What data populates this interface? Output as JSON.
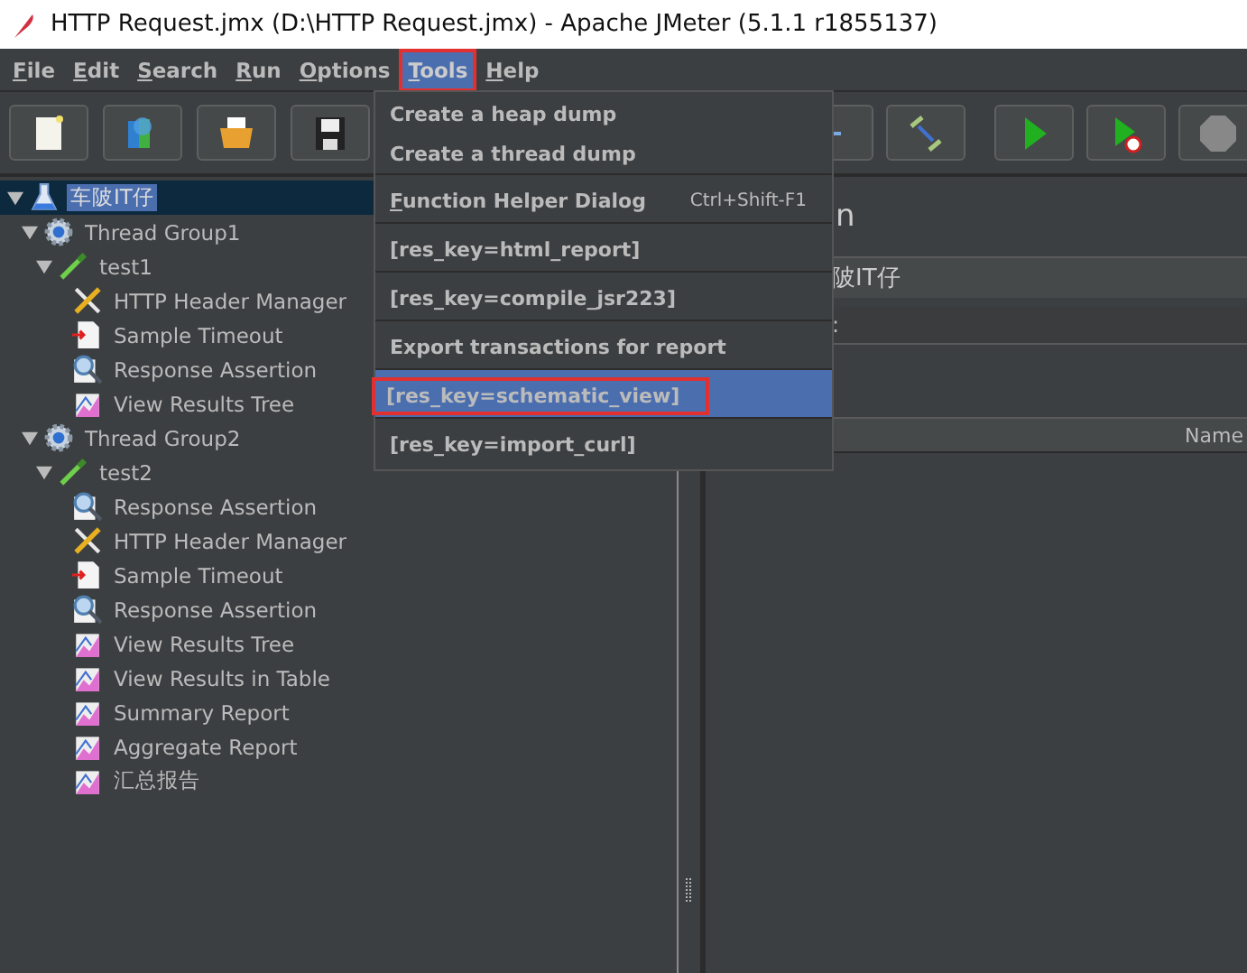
{
  "window": {
    "title": "HTTP Request.jmx (D:\\HTTP Request.jmx) - Apache JMeter (5.1.1 r1855137)"
  },
  "menu_bar": [
    {
      "label": "File",
      "selected": false,
      "annotated": false
    },
    {
      "label": "Edit",
      "selected": false,
      "annotated": false
    },
    {
      "label": "Search",
      "selected": false,
      "annotated": false
    },
    {
      "label": "Run",
      "selected": false,
      "annotated": false
    },
    {
      "label": "Options",
      "selected": false,
      "annotated": false
    },
    {
      "label": "Tools",
      "selected": true,
      "annotated": true
    },
    {
      "label": "Help",
      "selected": false,
      "annotated": false
    }
  ],
  "tools_menu": [
    {
      "label": "Create a heap dump",
      "separator_before": false,
      "mnemonic": false,
      "selected": false,
      "annotated": false
    },
    {
      "label": "Create a thread dump",
      "separator_before": false,
      "mnemonic": false,
      "selected": false,
      "annotated": false
    },
    {
      "label": "Function Helper Dialog",
      "shortcut": "Ctrl+Shift-F1",
      "separator_before": true,
      "mnemonic": true,
      "selected": false,
      "annotated": false
    },
    {
      "label": "[res_key=html_report]",
      "separator_before": true,
      "mnemonic": false,
      "selected": false,
      "annotated": false
    },
    {
      "label": "[res_key=compile_jsr223]",
      "separator_before": true,
      "mnemonic": false,
      "selected": false,
      "annotated": false
    },
    {
      "label": "Export transactions for report",
      "separator_before": true,
      "mnemonic": false,
      "selected": false,
      "annotated": false
    },
    {
      "label": "[res_key=schematic_view]",
      "separator_before": true,
      "mnemonic": false,
      "selected": true,
      "annotated": true
    },
    {
      "label": "[res_key=import_curl]",
      "separator_before": true,
      "mnemonic": false,
      "selected": false,
      "annotated": false
    }
  ],
  "tree": [
    {
      "label": "车陂IT仔",
      "kind": "test_plan",
      "selected": true,
      "expanded": true,
      "children": [
        {
          "label": "Thread Group1",
          "kind": "thread_group",
          "selected": false,
          "expanded": true,
          "children": [
            {
              "label": "test1",
              "kind": "controller",
              "selected": false,
              "expanded": true,
              "children": [
                {
                  "label": "HTTP Header Manager",
                  "kind": "config",
                  "selected": false
                },
                {
                  "label": "Sample Timeout",
                  "kind": "timeout",
                  "selected": false
                },
                {
                  "label": "Response Assertion",
                  "kind": "assertion",
                  "selected": false
                },
                {
                  "label": "View Results Tree",
                  "kind": "listener",
                  "selected": false
                }
              ]
            }
          ]
        },
        {
          "label": "Thread Group2",
          "kind": "thread_group",
          "selected": false,
          "expanded": true,
          "children": [
            {
              "label": "test2",
              "kind": "controller",
              "selected": false,
              "expanded": true,
              "children": [
                {
                  "label": "Response Assertion",
                  "kind": "assertion",
                  "selected": false
                },
                {
                  "label": "HTTP Header Manager",
                  "kind": "config",
                  "selected": false
                },
                {
                  "label": "Sample Timeout",
                  "kind": "timeout",
                  "selected": false
                },
                {
                  "label": "Response Assertion",
                  "kind": "assertion",
                  "selected": false
                },
                {
                  "label": "View Results Tree",
                  "kind": "listener",
                  "selected": false
                },
                {
                  "label": "View Results in Table",
                  "kind": "listener",
                  "selected": false
                },
                {
                  "label": "Summary Report",
                  "kind": "listener",
                  "selected": false
                },
                {
                  "label": "Aggregate Report",
                  "kind": "listener",
                  "selected": false
                },
                {
                  "label": "汇总报告",
                  "kind": "listener",
                  "selected": false
                }
              ]
            }
          ]
        }
      ]
    }
  ],
  "panel": {
    "title": "n",
    "name_value": "陂IT仔",
    "comments_label": ":",
    "table": {
      "columns": [
        "Name"
      ]
    }
  }
}
